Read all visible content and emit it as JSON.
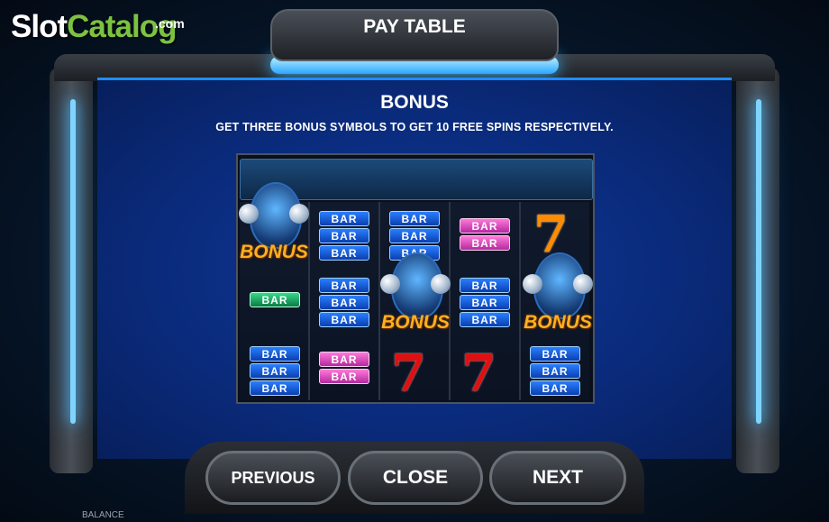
{
  "logo": {
    "slot": "Slot",
    "catalog": "Catalog",
    "com": ".com"
  },
  "header": {
    "title": "PAY TABLE"
  },
  "content": {
    "heading": "BONUS",
    "description": "GET THREE BONUS SYMBOLS TO GET 10 FREE SPINS RESPECTIVELY."
  },
  "reels": {
    "bar_label": "BAR",
    "bonus_label": "BONUS",
    "seven_label": "7"
  },
  "buttons": {
    "previous": "PREVIOUS",
    "close": "CLOSE",
    "next": "NEXT"
  },
  "footer": {
    "balance_label": "BALANCE"
  },
  "colors": {
    "accent": "#1e8cff",
    "panel": "#0a2a7a",
    "bonus_gold": "#ffb020",
    "seven_red": "#e01010"
  }
}
